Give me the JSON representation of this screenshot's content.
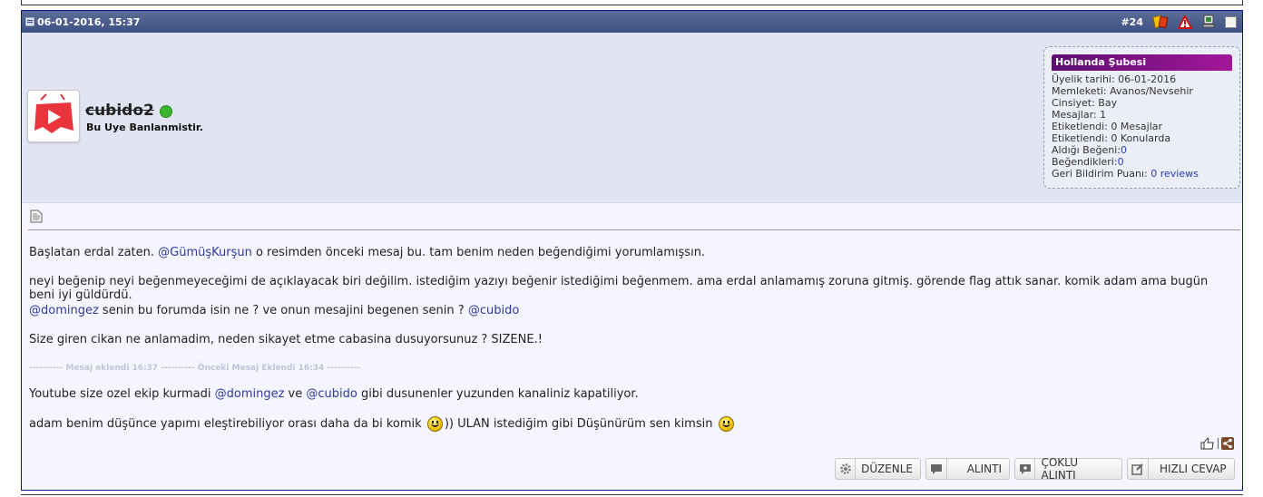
{
  "header": {
    "date": "06-01-2016, 15:37",
    "post_number": "#24"
  },
  "user": {
    "name": "cubido2",
    "title": "Bu Uye Banlanmistir."
  },
  "info": {
    "group": "Hollanda Şubesi",
    "rows": [
      {
        "label": "Üyelik tarihi:",
        "value": " 06-01-2016"
      },
      {
        "label": "Memleketi:",
        "value": " Avanos/Nevsehir"
      },
      {
        "label": "Cinsiyet:",
        "value": " Bay"
      },
      {
        "label": "Mesajlar:",
        "value": " 1"
      },
      {
        "label": "Etiketlendi:",
        "value": " 0 Mesajlar"
      },
      {
        "label": "Etiketlendi:",
        "value": " 0 Konularda"
      }
    ],
    "liked_label": "Aldığı Beğeni:",
    "liked_value": "0",
    "likes_label": "Beğendikleri:",
    "likes_value": "0",
    "feedback_label": "Geri Bildirim Puanı:",
    "feedback_value": "0 reviews"
  },
  "message": {
    "p1_pre": "Başlatan erdal zaten. ",
    "p1_mention": "@GümüşKurşun",
    "p1_post": " o resimden önceki mesaj bu. tam benim neden beğendiğimi yorumlamışsın.",
    "p2": "neyi beğenip neyi beğenmeyeceğimi de açıklayacak biri değilim. istediğim yazıyı beğenir istediğimi beğenmem. ama erdal anlamamış zoruna gitmiş. görende flag attık sanar. komik adam ama bugün beni iyi güldürdü.",
    "p3_mention1": "@domingez",
    "p3_mid": " senin bu forumda isin ne ? ve onun mesajini begenen senin ? ",
    "p3_mention2": "@cubido",
    "p4": "Size giren cikan ne anlamadim, neden sikayet etme cabasina dusuyorsunuz ? SIZENE.!",
    "separator": "---------- Mesaj eklendi 16:37 ---------- Önceki Mesaj Eklendi 16:34 ----------",
    "p5_pre": "Youtube size ozel ekip kurmadi ",
    "p5_mention1": "@domingez",
    "p5_mid": " ve ",
    "p5_mention2": "@cubido",
    "p5_post": " gibi dusunenler yuzunden kanaliniz kapatiliyor.",
    "p6_pre": "adam benim düşünce yapımı eleştirebiliyor orası daha da bi komik ",
    "p6_mid": ")) ULAN istediğim gibi Düşünürüm sen kimsin "
  },
  "buttons": {
    "edit": "DÜZENLE",
    "quote": "ALINTI",
    "multiquote": "ÇOKLU ALINTI",
    "quickreply": "HIZLI CEVAP"
  },
  "colors": {
    "header_bg": "#3e5083",
    "userbar_bg": "#e1e4f2",
    "group_bg": "#a2179a",
    "mention": "#2e3a9c"
  }
}
